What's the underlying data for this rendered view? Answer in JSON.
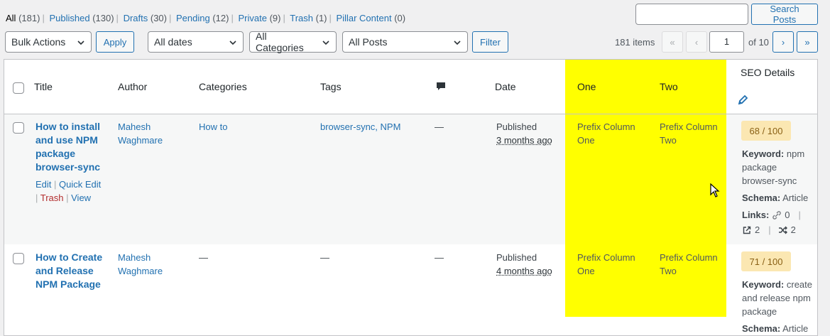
{
  "status_links": [
    {
      "label": "All",
      "count": "(181)",
      "current": true
    },
    {
      "label": "Published",
      "count": "(130)"
    },
    {
      "label": "Drafts",
      "count": "(30)"
    },
    {
      "label": "Pending",
      "count": "(12)"
    },
    {
      "label": "Private",
      "count": "(9)"
    },
    {
      "label": "Trash",
      "count": "(1)"
    },
    {
      "label": "Pillar Content",
      "count": "(0)"
    }
  ],
  "search": {
    "value": "",
    "button_label": "Search Posts"
  },
  "tablenav": {
    "bulk_actions": "Bulk Actions",
    "apply_label": "Apply",
    "dates_filter": "All dates",
    "categories_filter": "All Categories",
    "posts_filter": "All Posts",
    "filter_label": "Filter",
    "items_count": "181 items",
    "first_page": "«",
    "prev_page": "‹",
    "current_page": "1",
    "of_pages": "of 10",
    "next_page": "›",
    "last_page": "»"
  },
  "columns": {
    "title": "Title",
    "author": "Author",
    "categories": "Categories",
    "tags": "Tags",
    "comments_icon": "comment-icon",
    "date": "Date",
    "one": "One",
    "two": "Two",
    "seo_details": "SEO Details",
    "seo_edit_icon": "pencil-icon"
  },
  "colors": {
    "highlight": "#ffff00",
    "link": "#2271b1",
    "seo_score_bg": "#fbe7b2"
  },
  "rows": [
    {
      "title_lines": [
        "How to install",
        "and use NPM",
        "package",
        "browser-sync"
      ],
      "actions": {
        "edit": "Edit",
        "quick_edit": "Quick Edit",
        "trash": "Trash",
        "view": "View"
      },
      "author_lines": [
        "Mahesh",
        "Waghmare"
      ],
      "categories": "How to",
      "tags": "browser-sync, NPM",
      "comments": "—",
      "date_status": "Published",
      "date_relative": "3 months ago",
      "one_lines": [
        "Prefix Column",
        "One"
      ],
      "two_lines": [
        "Prefix Column",
        "Two"
      ],
      "seo_score": "68 / 100",
      "keyword_label": "Keyword:",
      "keyword_lines": [
        "npm",
        "package",
        "browser-sync"
      ],
      "schema_label": "Schema:",
      "schema": "Article",
      "links_label": "Links:",
      "internal_links": "0",
      "external_links": "2",
      "incoming_links": "2"
    },
    {
      "title_lines": [
        "How to Create",
        "and Release",
        "NPM Package"
      ],
      "author_lines": [
        "Mahesh",
        "Waghmare"
      ],
      "categories": "—",
      "tags": "—",
      "comments": "—",
      "date_status": "Published",
      "date_relative": "4 months ago",
      "one_lines": [
        "Prefix Column",
        "One"
      ],
      "two_lines": [
        "Prefix Column",
        "Two"
      ],
      "seo_score": "71 / 100",
      "keyword_label": "Keyword:",
      "keyword_lines": [
        "create",
        "and release npm",
        "package"
      ],
      "schema_label": "Schema:",
      "schema": "Article"
    }
  ]
}
